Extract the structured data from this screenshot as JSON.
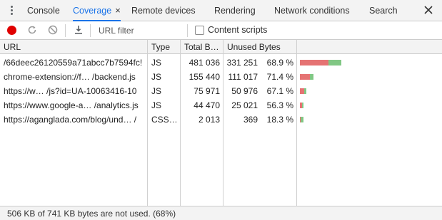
{
  "tabs": [
    {
      "label": "Console"
    },
    {
      "label": "Coverage",
      "active": true,
      "close": "×"
    },
    {
      "label": "Remote devices"
    },
    {
      "label": "Rendering"
    },
    {
      "label": "Network conditions"
    },
    {
      "label": "Search"
    }
  ],
  "toolbar": {
    "filter_placeholder": "URL filter",
    "content_scripts_label": "Content scripts",
    "content_scripts_checked": false
  },
  "table": {
    "headers": {
      "url": "URL",
      "type": "Type",
      "total": "Total B…",
      "unused": "Unused Bytes"
    },
    "rows": [
      {
        "url": "/66deec26120559a71abcc7b7594fc!",
        "type": "JS",
        "total": "481 036",
        "unused": "331 251",
        "pct": "68.9 %",
        "used_fraction": 0.311
      },
      {
        "url": "chrome-extension://f…   /backend.js",
        "type": "JS",
        "total": "155 440",
        "unused": "111 017",
        "pct": "71.4 %",
        "used_fraction": 0.286
      },
      {
        "url": "https://w…   /js?id=UA-10063416-10",
        "type": "JS",
        "total": "75 971",
        "unused": "50 976",
        "pct": "67.1 %",
        "used_fraction": 0.329
      },
      {
        "url": "https://www.google-a…   /analytics.js",
        "type": "JS",
        "total": "44 470",
        "unused": "25 021",
        "pct": "56.3 %",
        "used_fraction": 0.437
      },
      {
        "url": "https://aganglada.com/blog/und…   /",
        "type": "CSS…",
        "total": "2 013",
        "unused": "369",
        "pct": "18.3 %",
        "used_fraction": 0.817
      }
    ],
    "max_total": 481036
  },
  "status": {
    "text": "506 KB of 741 KB bytes are not used. (68%)"
  },
  "colors": {
    "accent": "#1a73e8",
    "record": "#e00000",
    "unused_bar": "#e57373",
    "used_bar": "#81c784"
  },
  "icons": [
    "kebab-menu-icon",
    "record-icon",
    "reload-icon",
    "clear-icon",
    "download-icon",
    "close-icon"
  ]
}
